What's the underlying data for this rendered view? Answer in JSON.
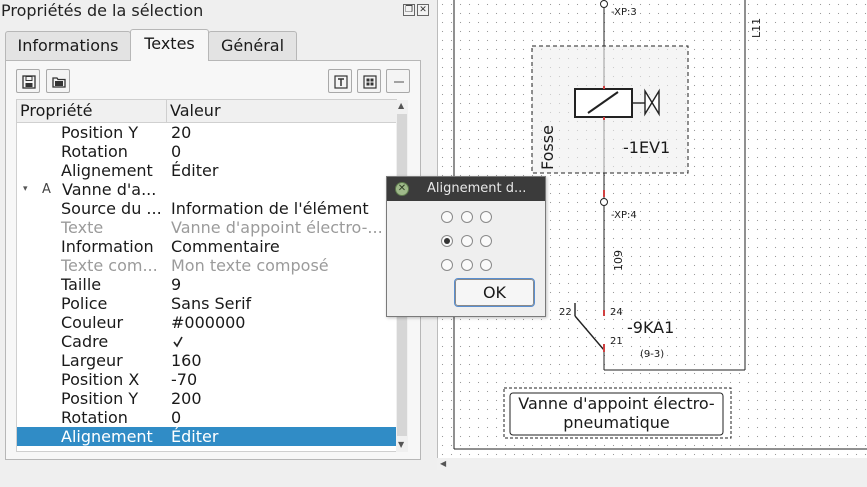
{
  "panel": {
    "title": "Propriétés de la sélection",
    "float_icon": "float-icon",
    "close_icon": "close-icon",
    "tabs": [
      {
        "label": "Informations",
        "active": false
      },
      {
        "label": "Textes",
        "active": true
      },
      {
        "label": "Général",
        "active": false
      }
    ],
    "toolbar_icons": [
      "save-icon",
      "open-folder-icon",
      "add-text-icon",
      "text-group-icon",
      "remove-icon"
    ],
    "table": {
      "headers": {
        "property": "Propriété",
        "value": "Valeur"
      },
      "rows": [
        {
          "key": "Position Y",
          "value": "20"
        },
        {
          "key": "Rotation",
          "value": "0"
        },
        {
          "key": "Alignement",
          "value": "Éditer"
        },
        {
          "key": "Vanne d'a...",
          "value": "",
          "group": true,
          "group_icon_text": "A"
        },
        {
          "key": "Source du ...",
          "value": "Information de l'élément"
        },
        {
          "key": "Texte",
          "value": "Vanne d'appoint électro-...",
          "disabled": true
        },
        {
          "key": "Information",
          "value": "Commentaire"
        },
        {
          "key": "Texte com...",
          "value": "Mon texte composé",
          "disabled": true
        },
        {
          "key": "Taille",
          "value": "9"
        },
        {
          "key": "Police",
          "value": "Sans Serif"
        },
        {
          "key": "Couleur",
          "value": "#000000"
        },
        {
          "key": "Cadre",
          "value": "",
          "checkbox": true,
          "checked": true
        },
        {
          "key": "Largeur",
          "value": "160"
        },
        {
          "key": "Position X",
          "value": "-70"
        },
        {
          "key": "Position Y",
          "value": "200"
        },
        {
          "key": "Rotation",
          "value": "0"
        },
        {
          "key": "Alignement",
          "value": "Éditer",
          "selected": true
        }
      ]
    },
    "selection_color": "#308cc6"
  },
  "canvas": {
    "labels": {
      "xp3": "-XP:3",
      "l11": "L11",
      "fosse": "Fosse",
      "ev1": "-1EV1",
      "xp4": "-XP:4",
      "wire109": "109",
      "pin22": "22",
      "pin24": "24",
      "pin21": "21",
      "ka1": "-9KA1",
      "ref93": "(9-3)"
    },
    "comment_box": {
      "line1": "Vanne d'appoint électro-",
      "line2": "pneumatique"
    }
  },
  "dialog": {
    "title": "Alignement d...",
    "ok_label": "OK",
    "selected_alignment": "middle-left"
  }
}
